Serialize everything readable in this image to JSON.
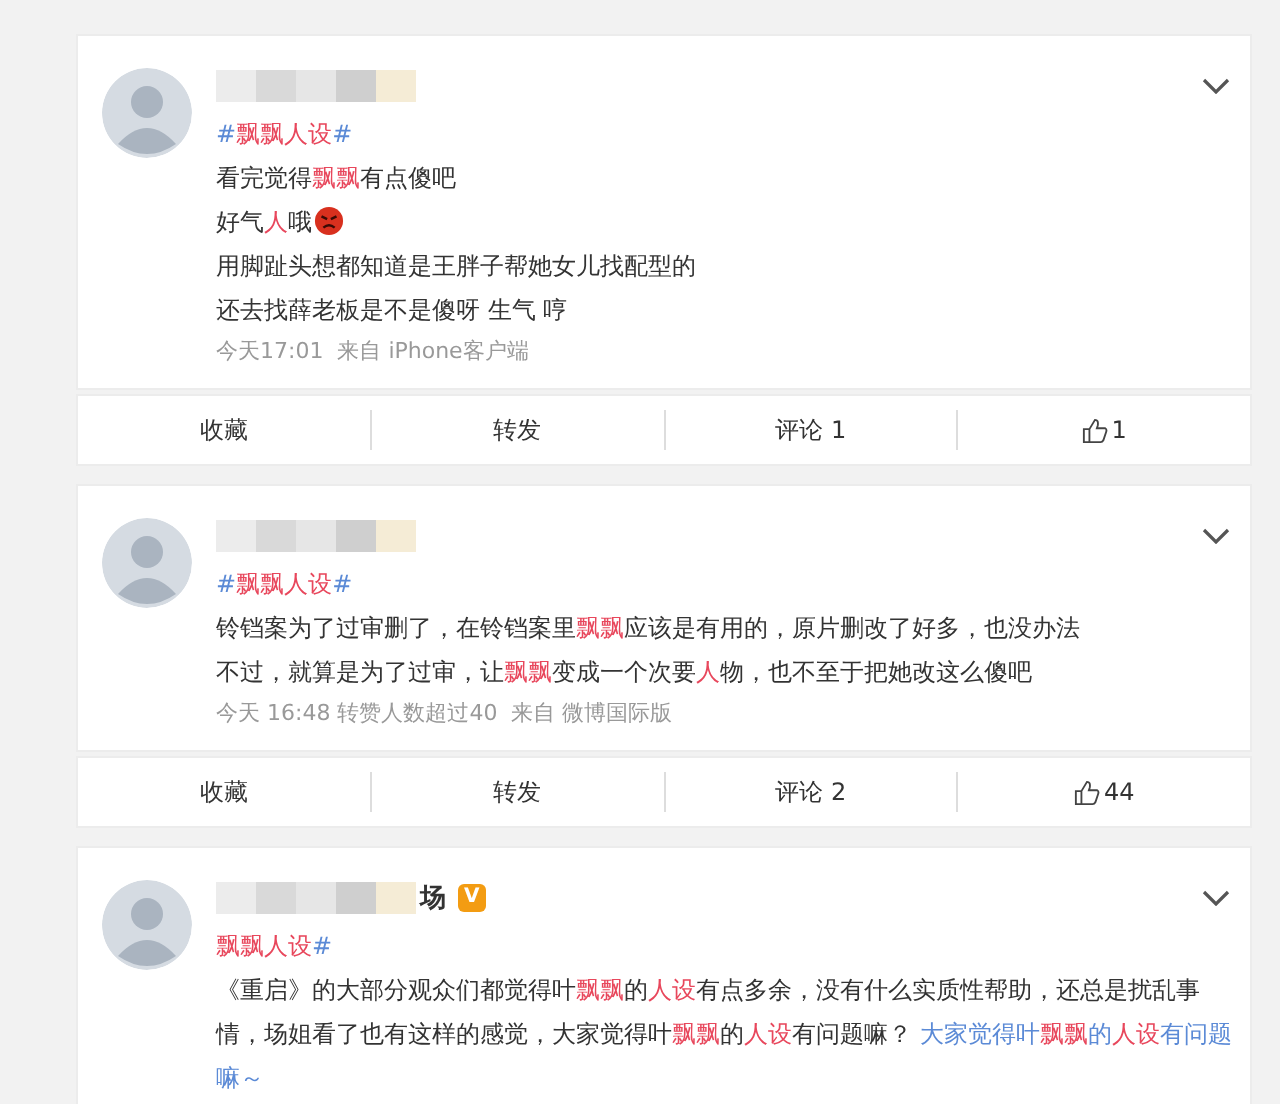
{
  "posts": [
    {
      "tag": [
        {
          "text": "#",
          "kind": "link"
        },
        {
          "text": "飘飘人设",
          "kind": "hl"
        },
        {
          "text": "#",
          "kind": "link"
        }
      ],
      "lines": [
        [
          {
            "text": "看完觉得",
            "kind": "plain"
          },
          {
            "text": "飘飘",
            "kind": "hl"
          },
          {
            "text": "有点傻吧",
            "kind": "plain"
          }
        ],
        [
          {
            "text": "好气",
            "kind": "plain"
          },
          {
            "text": "人",
            "kind": "hl"
          },
          {
            "text": "哦",
            "kind": "plain"
          },
          {
            "kind": "angry_emoji"
          }
        ],
        [
          {
            "text": "用脚趾头想都知道是王胖子帮她女儿找配型的",
            "kind": "plain"
          }
        ],
        [
          {
            "text": "还去找薛老板是不是傻呀 生气 哼",
            "kind": "plain"
          }
        ]
      ],
      "meta": "今天17:01  来自 iPhone客户端",
      "actions": [
        {
          "kind": "favorite",
          "label": "收藏"
        },
        {
          "kind": "repost",
          "label": "转发"
        },
        {
          "kind": "comment",
          "label": "评论 1"
        },
        {
          "kind": "like",
          "label": "1"
        }
      ]
    },
    {
      "tag": [
        {
          "text": "#",
          "kind": "link"
        },
        {
          "text": "飘飘人设",
          "kind": "hl"
        },
        {
          "text": "#",
          "kind": "link"
        }
      ],
      "lines": [
        [
          {
            "text": "铃铛案为了过审删了，在铃铛案里",
            "kind": "plain"
          },
          {
            "text": "飘飘",
            "kind": "hl"
          },
          {
            "text": "应该是有用的，原片删改了好多，也没办法",
            "kind": "plain"
          }
        ],
        [
          {
            "text": "不过，就算是为了过审，让",
            "kind": "plain"
          },
          {
            "text": "飘飘",
            "kind": "hl"
          },
          {
            "text": "变成一个次要",
            "kind": "plain"
          },
          {
            "text": "人",
            "kind": "hl"
          },
          {
            "text": "物，也不至于把她改这么傻吧",
            "kind": "plain"
          }
        ]
      ],
      "meta": "今天 16:48 转赞人数超过40  来自 微博国际版",
      "actions": [
        {
          "kind": "favorite",
          "label": "收藏"
        },
        {
          "kind": "repost",
          "label": "转发"
        },
        {
          "kind": "comment",
          "label": "评论 2"
        },
        {
          "kind": "like",
          "label": "44"
        }
      ]
    },
    {
      "name": "场",
      "badge": "V",
      "tag": [
        {
          "text": "飘飘人设",
          "kind": "hl"
        },
        {
          "text": "#",
          "kind": "link"
        }
      ],
      "lines": [
        [
          {
            "text": "《重启》的大部分观众们都觉得叶",
            "kind": "plain"
          },
          {
            "text": "飘飘",
            "kind": "hl"
          },
          {
            "text": "的",
            "kind": "plain"
          },
          {
            "text": "人设",
            "kind": "hl"
          },
          {
            "text": "有点多余，没有什么实质性帮助，还总是扰乱事",
            "kind": "plain"
          }
        ],
        [
          {
            "text": "情，场姐看了也有这样的感觉，大家觉得叶",
            "kind": "plain"
          },
          {
            "text": "飘飘",
            "kind": "hl"
          },
          {
            "text": "的",
            "kind": "plain"
          },
          {
            "text": "人设",
            "kind": "hl"
          },
          {
            "text": "有问题嘛？ ",
            "kind": "plain"
          },
          {
            "text": "大家觉得叶",
            "kind": "link"
          },
          {
            "text": "飘飘",
            "kind": "hl"
          },
          {
            "text": "的",
            "kind": "link"
          },
          {
            "text": "人设",
            "kind": "hl"
          },
          {
            "text": "有问题",
            "kind": "link"
          }
        ],
        [
          {
            "text": "嘛～",
            "kind": "link"
          }
        ]
      ]
    }
  ]
}
